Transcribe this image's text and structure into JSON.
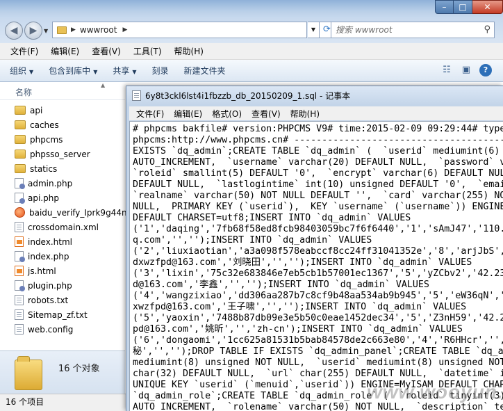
{
  "explorer": {
    "address": {
      "path": "wwwroot"
    },
    "search": {
      "placeholder": "搜索 wwwroot"
    },
    "menu": [
      "文件(F)",
      "编辑(E)",
      "查看(V)",
      "工具(T)",
      "帮助(H)"
    ],
    "toolbar": {
      "organize": "组织",
      "include": "包含到库中",
      "share": "共享",
      "burn": "刻录",
      "new_folder": "新建文件夹"
    },
    "column_header": "名称",
    "files": [
      {
        "name": "api",
        "icon": "folder-icon"
      },
      {
        "name": "caches",
        "icon": "folder-icon"
      },
      {
        "name": "phpcms",
        "icon": "folder-icon"
      },
      {
        "name": "phpsso_server",
        "icon": "folder-icon"
      },
      {
        "name": "statics",
        "icon": "folder-icon"
      },
      {
        "name": "admin.php",
        "icon": "php-file-icon"
      },
      {
        "name": "api.php",
        "icon": "php-file-icon"
      },
      {
        "name": "baidu_verify_Iprk9g44n",
        "icon": "baidu-file-icon"
      },
      {
        "name": "crossdomain.xml",
        "icon": "xml-file-icon"
      },
      {
        "name": "index.html",
        "icon": "html-file-icon"
      },
      {
        "name": "index.php",
        "icon": "php-file-icon"
      },
      {
        "name": "js.html",
        "icon": "html-file-icon"
      },
      {
        "name": "plugin.php",
        "icon": "php-file-icon"
      },
      {
        "name": "robots.txt",
        "icon": "text-file-icon"
      },
      {
        "name": "Sitemap_zf.txt",
        "icon": "text-file-icon"
      },
      {
        "name": "web.config",
        "icon": "config-file-icon"
      }
    ],
    "details_count": "16 个对象",
    "status": "16 个项目"
  },
  "notepad": {
    "title": "6y8t3ckl6lst4i1fbzzb_db_20150209_1.sql - 记事本",
    "menu": [
      "文件(F)",
      "编辑(E)",
      "格式(O)",
      "查看(V)",
      "帮助(H)"
    ],
    "lines": [
      "# phpcms bakfile# version:PHPCMS V9# time:2015-02-09 09:29:44# type:",
      "phpcms:http://www.phpcms.cn# -----------------------------------------",
      "EXISTS `dq_admin`;CREATE TABLE `dq_admin` (  `userid` mediumint(6) u",
      "AUTO_INCREMENT,  `username` varchar(20) DEFAULT NULL,  `password` va",
      "`roleid` smallint(5) DEFAULT '0',  `encrypt` varchar(6) DEFAULT NULL",
      "DEFAULT NULL,  `lastlogintime` int(10) unsigned DEFAULT '0',  `email",
      "`realname` varchar(50) NOT NULL DEFAULT '',  `card` varchar(255) NOT",
      "NULL,  PRIMARY KEY (`userid`),  KEY `username` (`username`)) ENGINE=",
      "DEFAULT CHARSET=utf8;INSERT INTO `dq_admin` VALUES",
      "('1','daqing','7fb68f58ed8fcb98403059bc7f6f6440','1','sAmJ47','110.8",
      "q.com','','');INSERT INTO `dq_admin` VALUES",
      "('2','liuxiaotian','a3a098f578eabccf8cc24ff31041352e','8','arjJbS','",
      "dxwzfpd@163.com','刘晓田','','');INSERT INTO `dq_admin` VALUES",
      "('3','lixin','75c32e683846e7eb5cb1b57001ec1367','5','yZCbv2','42.236",
      "d@163.com','李鑫','','');INSERT INTO `dq_admin` VALUES",
      "('4','wangzixiao','dd306aa287b7c8cf9b48aa534ab9b945','5','eW36qN','",
      "xwzfpd@163.com','王子啸','','');INSERT INTO `dq_admin` VALUES",
      "('5','yaoxin','7488b87db09e3e5b50c0eae1452dec34','5','Z3nH59','42.23",
      "pd@163.com','姚昕','','zh-cn');INSERT INTO `dq_admin` VALUES",
      "('6','dongaomi','1cc625a81531b5bab84578de2c663e80','4','R6HHcr','','",
      "秘','','');DROP TABLE IF EXISTS `dq_admin_panel`;CREATE TABLE `dq_ad",
      "mediumint(8) unsigned NOT NULL,  `userid` mediumint(8) unsigned NOT",
      "char(32) DEFAULT NULL,  `url` char(255) DEFAULT NULL,  `datetime` in",
      "UNIQUE KEY `userid` (`menuid`,`userid`)) ENGINE=MyISAM DEFAULT CHARS",
      "`dq_admin_role`;CREATE TABLE `dq_admin_role` (  `roleid` tinyint(3)",
      "AUTO_INCREMENT,  `rolename` varchar(50) NOT NULL,  `description` tex"
    ]
  },
  "watermark": "www.wooyun.org"
}
